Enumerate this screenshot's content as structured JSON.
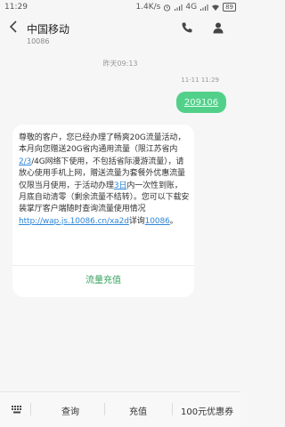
{
  "status": {
    "time": "11:29",
    "network_speed": "1.4K/s",
    "network_type": "4G",
    "battery": "89"
  },
  "header": {
    "title": "中国移动",
    "subtitle": "10086"
  },
  "conversation": {
    "date_separator": "昨天09:13",
    "sent_time": "11-11 11:29",
    "sent_message": "209106",
    "received_message": {
      "part1": "尊敬的客户，您已经办理了畅爽20G流量活动，本月向您赠送20G省内通用流量（限江苏省内",
      "link1": "2/3",
      "part2": "/4G网络下使用，不包括省际漫游流量），请放心使用手机上网，赠送流量为套餐外优惠流量仅限当月使用，于活动办理",
      "link2": "3日",
      "part3": "内一次性到账，月底自动清零（剩余流量不结转）。您可以下载安装掌厅客户端随时查询流量使用情况",
      "link3": "http://wap.js.10086.cn/xa2d",
      "part4": "详询",
      "link4": "10086",
      "part5": "。"
    },
    "action_label": "流量充值"
  },
  "bottombar": {
    "query_label": "查询",
    "recharge_label": "充值",
    "offer_label": "100元优惠券"
  }
}
